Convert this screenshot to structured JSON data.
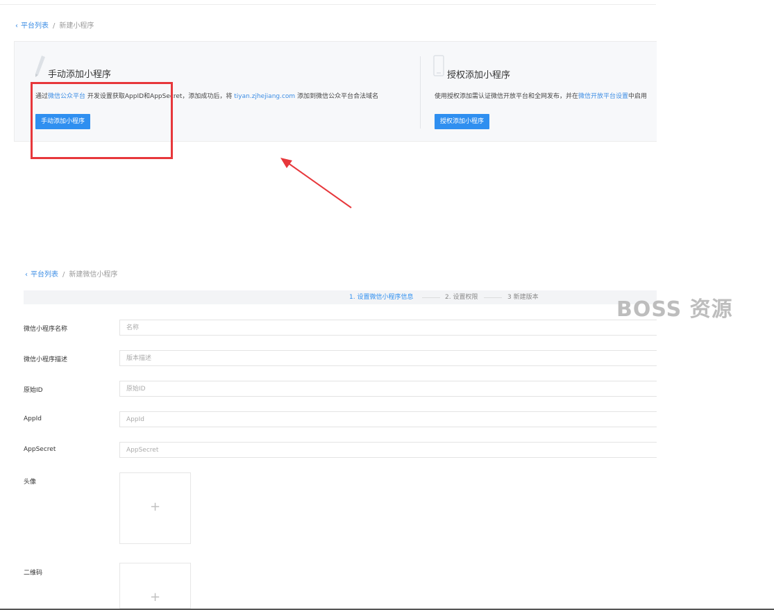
{
  "top_breadcrumb": {
    "back": "平台列表",
    "separator": "/",
    "current": "新建小程序"
  },
  "manual_card": {
    "title": "手动添加小程序",
    "desc_prefix": "通过",
    "desc_link": "微信公众平台",
    "desc_middle": " 开发设置获取AppID和AppSecret，添加成功后，将 ",
    "desc_domain": "tiyan.zjhejiang.com",
    "desc_suffix": " 添加到微信公众平台合法域名",
    "button": "手动添加小程序"
  },
  "auth_card": {
    "title": "授权添加小程序",
    "desc_prefix": "使用授权添加需认证微信开放平台和全网发布，并在",
    "desc_link": "微信开放平台设置",
    "desc_suffix": "中启用",
    "button": "授权添加小程序"
  },
  "form_breadcrumb": {
    "back": "平台列表",
    "separator": "/",
    "current": "新建微信小程序"
  },
  "steps": [
    {
      "label": "1. 设置微信小程序信息",
      "active": true
    },
    {
      "label": "2. 设置权限",
      "active": false
    },
    {
      "label": "3 新建版本",
      "active": false
    }
  ],
  "form": {
    "name": {
      "label": "微信小程序名称",
      "placeholder": "名称"
    },
    "desc": {
      "label": "微信小程序描述",
      "placeholder": "版本描述"
    },
    "original_id": {
      "label": "原始ID",
      "placeholder": "原始ID"
    },
    "appid": {
      "label": "AppId",
      "placeholder": "AppId"
    },
    "appsecret": {
      "label": "AppSecret",
      "placeholder": "AppSecret"
    },
    "avatar": {
      "label": "头像",
      "icon": "+"
    },
    "qrcode": {
      "label": "二维码",
      "icon": "+"
    }
  },
  "watermark": "BOSS 资源",
  "colors": {
    "accent": "#2f8ff0",
    "link": "#3c8de4",
    "highlight": "#e7373b"
  },
  "icons": [
    "chevron-left-icon",
    "pencil-icon",
    "phone-icon",
    "arrow-icon",
    "plus-icon"
  ]
}
